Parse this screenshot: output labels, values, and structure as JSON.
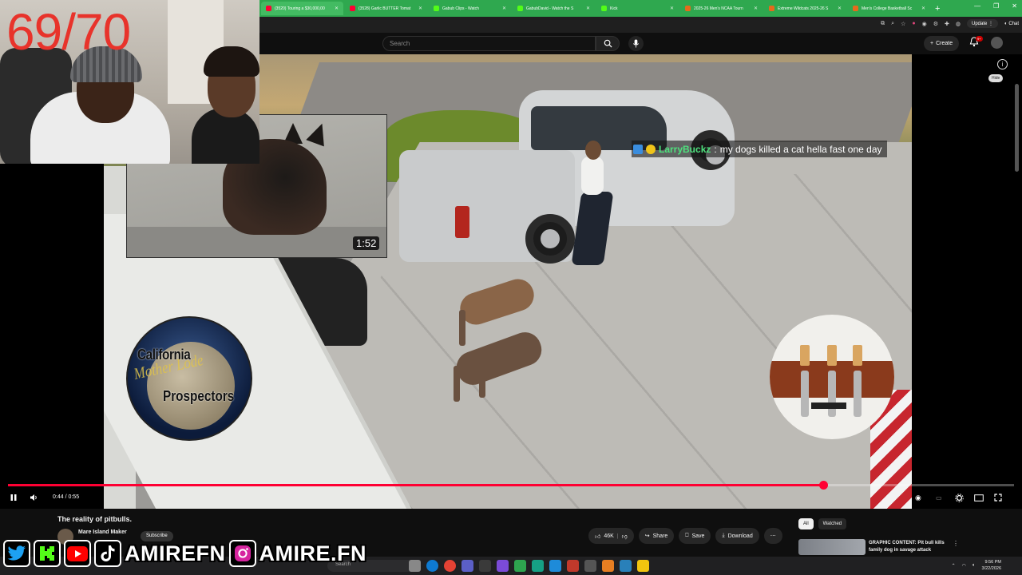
{
  "browser": {
    "tabs": [
      {
        "label": "(3520) Touring a $30,000,00",
        "color": "#ff0033",
        "active": true
      },
      {
        "label": "(3528) Garlic BUTTER Tomat",
        "color": "#ff0033"
      },
      {
        "label": "Gabub Clips - Watch",
        "color": "#53fc18"
      },
      {
        "label": "GabubDavid - Watch the S",
        "color": "#53fc18"
      },
      {
        "label": "Kick",
        "color": "#53fc18"
      },
      {
        "label": "2025-26 Men's NCAA Tourn",
        "color": "#e56a1c"
      },
      {
        "label": "Extreme Wildcats 2025-26 S",
        "color": "#e56a1c"
      },
      {
        "label": "Men's College Basketball Sc",
        "color": "#e56a1c"
      }
    ],
    "update_label": "Update",
    "chat_label": "Chat"
  },
  "youtube": {
    "search_placeholder": "Search",
    "create_label": "Create",
    "notif_badge": "9+",
    "hide_label": "Hide"
  },
  "video": {
    "chat_user": "LarryBuckz",
    "chat_sep": ":",
    "chat_message": "my dogs killed a cat hella fast one day",
    "clip_duration": "1:52",
    "logo_line1": "California",
    "logo_line2": "Mother Lode",
    "logo_line3": "Prospectors",
    "time_current": "0:44",
    "time_total": "0:55",
    "timecode": "0:44 / 0:55",
    "progress_fraction": 0.81
  },
  "below": {
    "title": "The reality of pitbulls.",
    "channel": "Mare Island Maker",
    "subscribe_label": "Subscribe",
    "likes": "46K",
    "share_label": "Share",
    "save_label": "Save",
    "download_label": "Download",
    "chips": [
      "All",
      "Watched"
    ],
    "rec_title": "GRAPHIC CONTENT: Pit bull kills family dog in savage attack"
  },
  "stream": {
    "counter": "69/70"
  },
  "social": {
    "handle1": "AMIREFN",
    "handle2": "AMIRE.FN"
  },
  "taskbar": {
    "search_placeholder": "Search",
    "time": "9:56 PM",
    "date": "3/22/2026"
  },
  "colors": {
    "accent": "#ff0033",
    "chat_user": "#4ee07d",
    "counter": "#e8332b",
    "tabbar": "#2fa84f"
  }
}
